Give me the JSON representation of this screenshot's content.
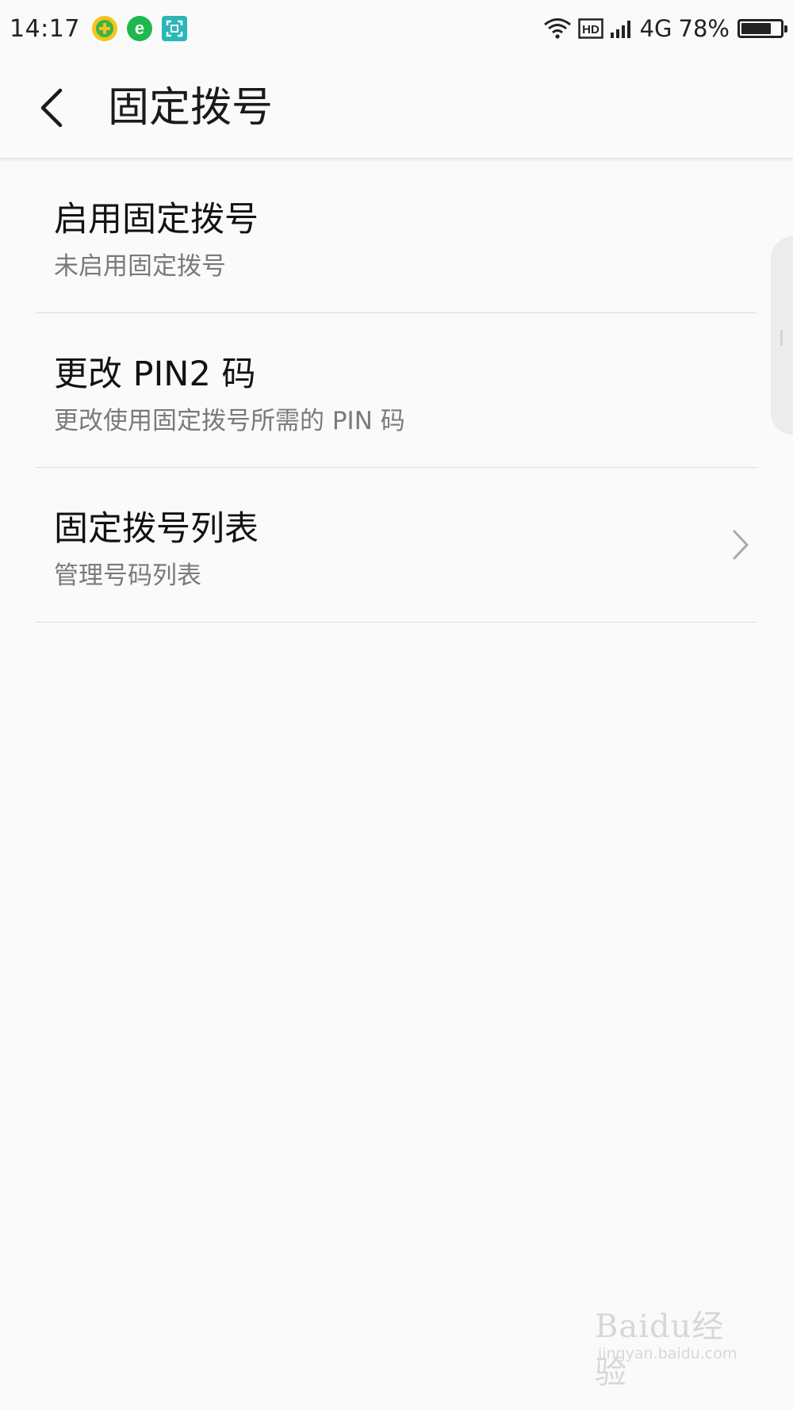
{
  "status_bar": {
    "time": "14:17",
    "app_icons": [
      "plus-shield-icon",
      "browser-e-icon",
      "scan-frame-icon"
    ],
    "hd_badge": "HD",
    "network_type": "4G",
    "battery_text": "78%",
    "battery_level": 0.78
  },
  "header": {
    "title": "固定拨号"
  },
  "settings": {
    "items": [
      {
        "title": "启用固定拨号",
        "subtitle": "未启用固定拨号"
      },
      {
        "title": "更改 PIN2 码",
        "subtitle": "更改使用固定拨号所需的 PIN 码"
      },
      {
        "title": "固定拨号列表",
        "subtitle": "管理号码列表"
      }
    ]
  },
  "watermark": {
    "logo_text": "Baidu经验",
    "url": "jingyan.baidu.com"
  },
  "colors": {
    "background": "#fafafa",
    "text_primary": "#121212",
    "text_secondary": "#7a7a7a",
    "divider": "#dcdcdc"
  }
}
